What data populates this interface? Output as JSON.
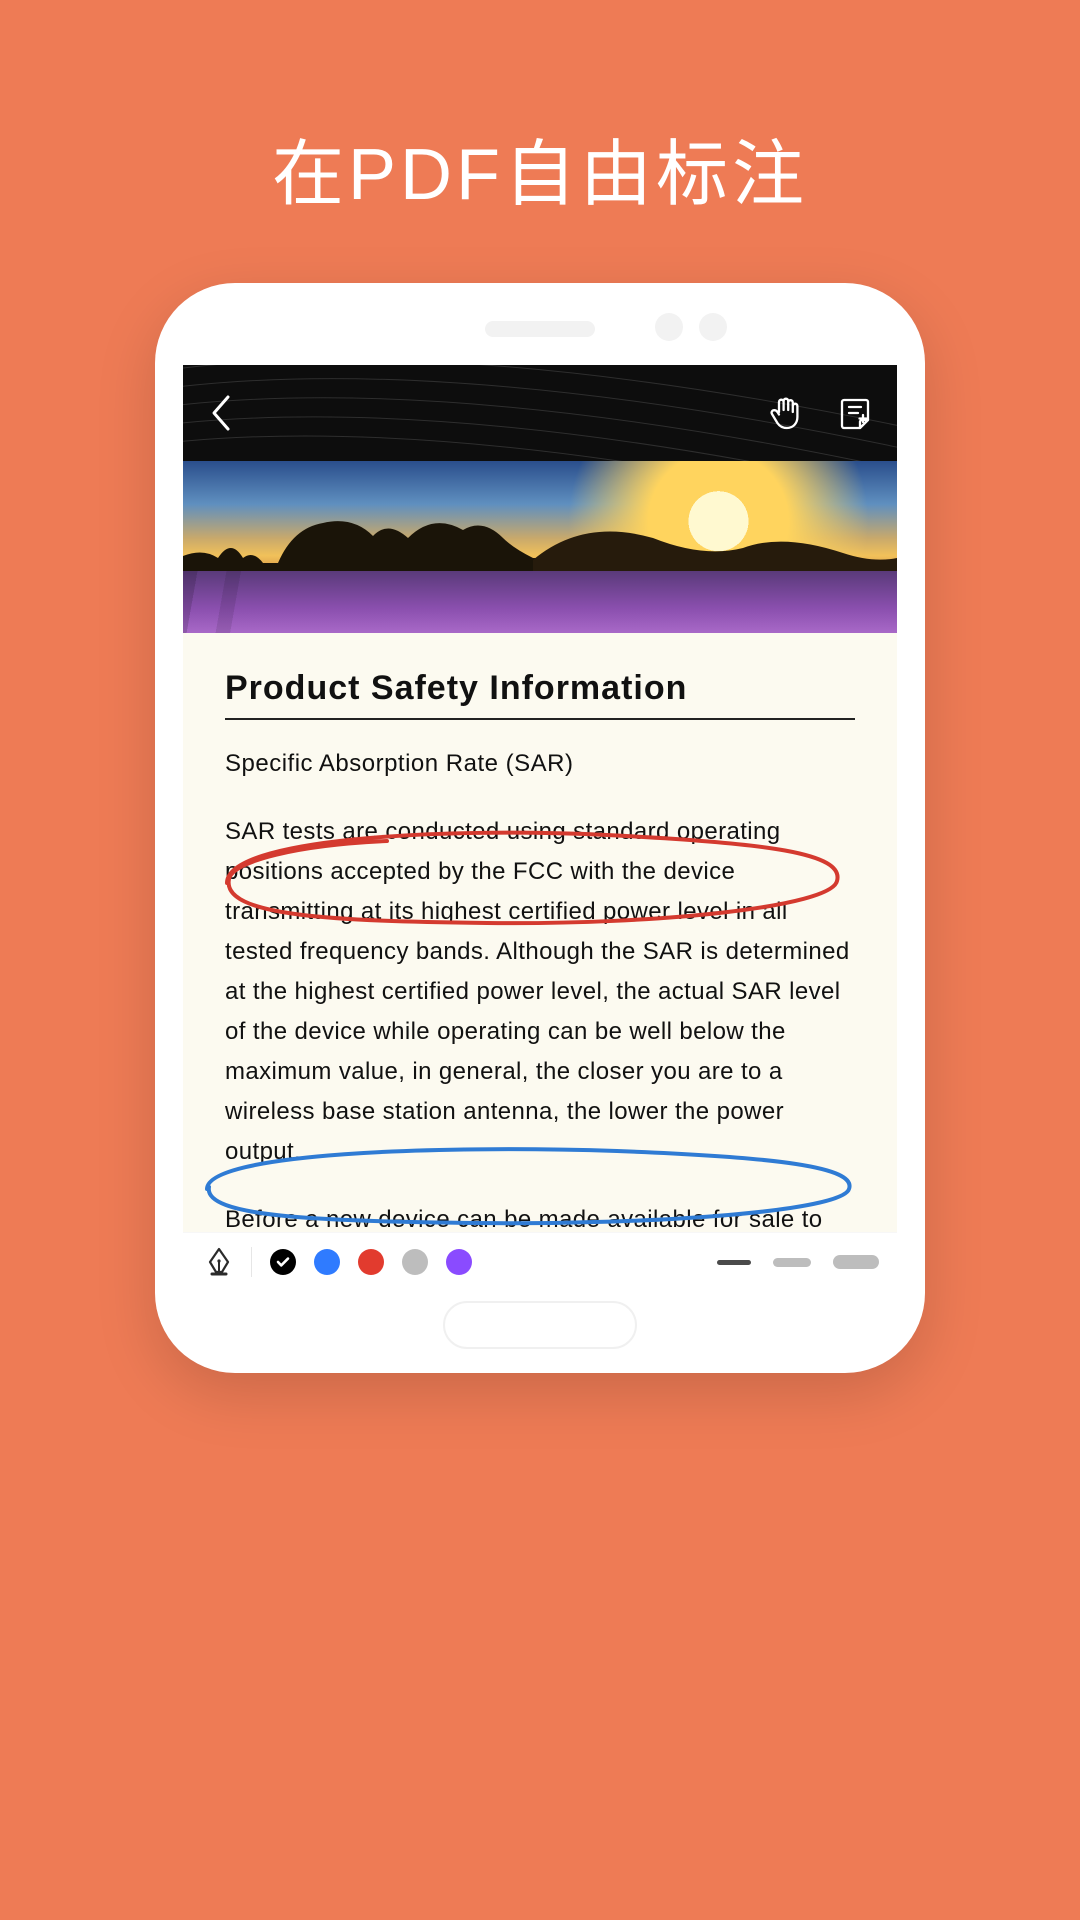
{
  "poster": {
    "title": "在PDF自由标注"
  },
  "doc": {
    "title": "Product Safety Information",
    "subtitle": "Specific Absorption Rate (SAR)",
    "para1": "SAR tests are conducted using standard operating positions accepted by the FCC with the device transmitting at its highest certified power level in all tested frequency bands. Although the SAR is determined at the highest certified power level, the actual SAR level of the device while operating can be well below the maximum value, in general, the closer you are to a wireless base station antenna, the lower the power output.",
    "para2": "Before a new device can be made available for sale to the public, it must be tested and certified by the FCC to ensure that it does not exceed the exposure limit established by the FCC. Tests for each device are performed in positions and locations as required by the FCC."
  },
  "toolbar": {
    "colors": [
      {
        "name": "black",
        "hex": "#000000",
        "selected": true
      },
      {
        "name": "blue",
        "hex": "#2f7bff",
        "selected": false
      },
      {
        "name": "red",
        "hex": "#e23b2e",
        "selected": false
      },
      {
        "name": "grey",
        "hex": "#bdbdbd",
        "selected": false
      },
      {
        "name": "purple",
        "hex": "#8a4bff",
        "selected": false
      }
    ],
    "stroke_selected_index": 0
  },
  "annotations": [
    {
      "shape": "ellipse",
      "color": "#d43a2f"
    },
    {
      "shape": "ellipse",
      "color": "#2f7bd4"
    }
  ],
  "icons": {
    "back": "chevron-left-icon",
    "hand": "hand-pointing-icon",
    "note": "note-add-icon",
    "pen": "fountain-pen-icon"
  }
}
